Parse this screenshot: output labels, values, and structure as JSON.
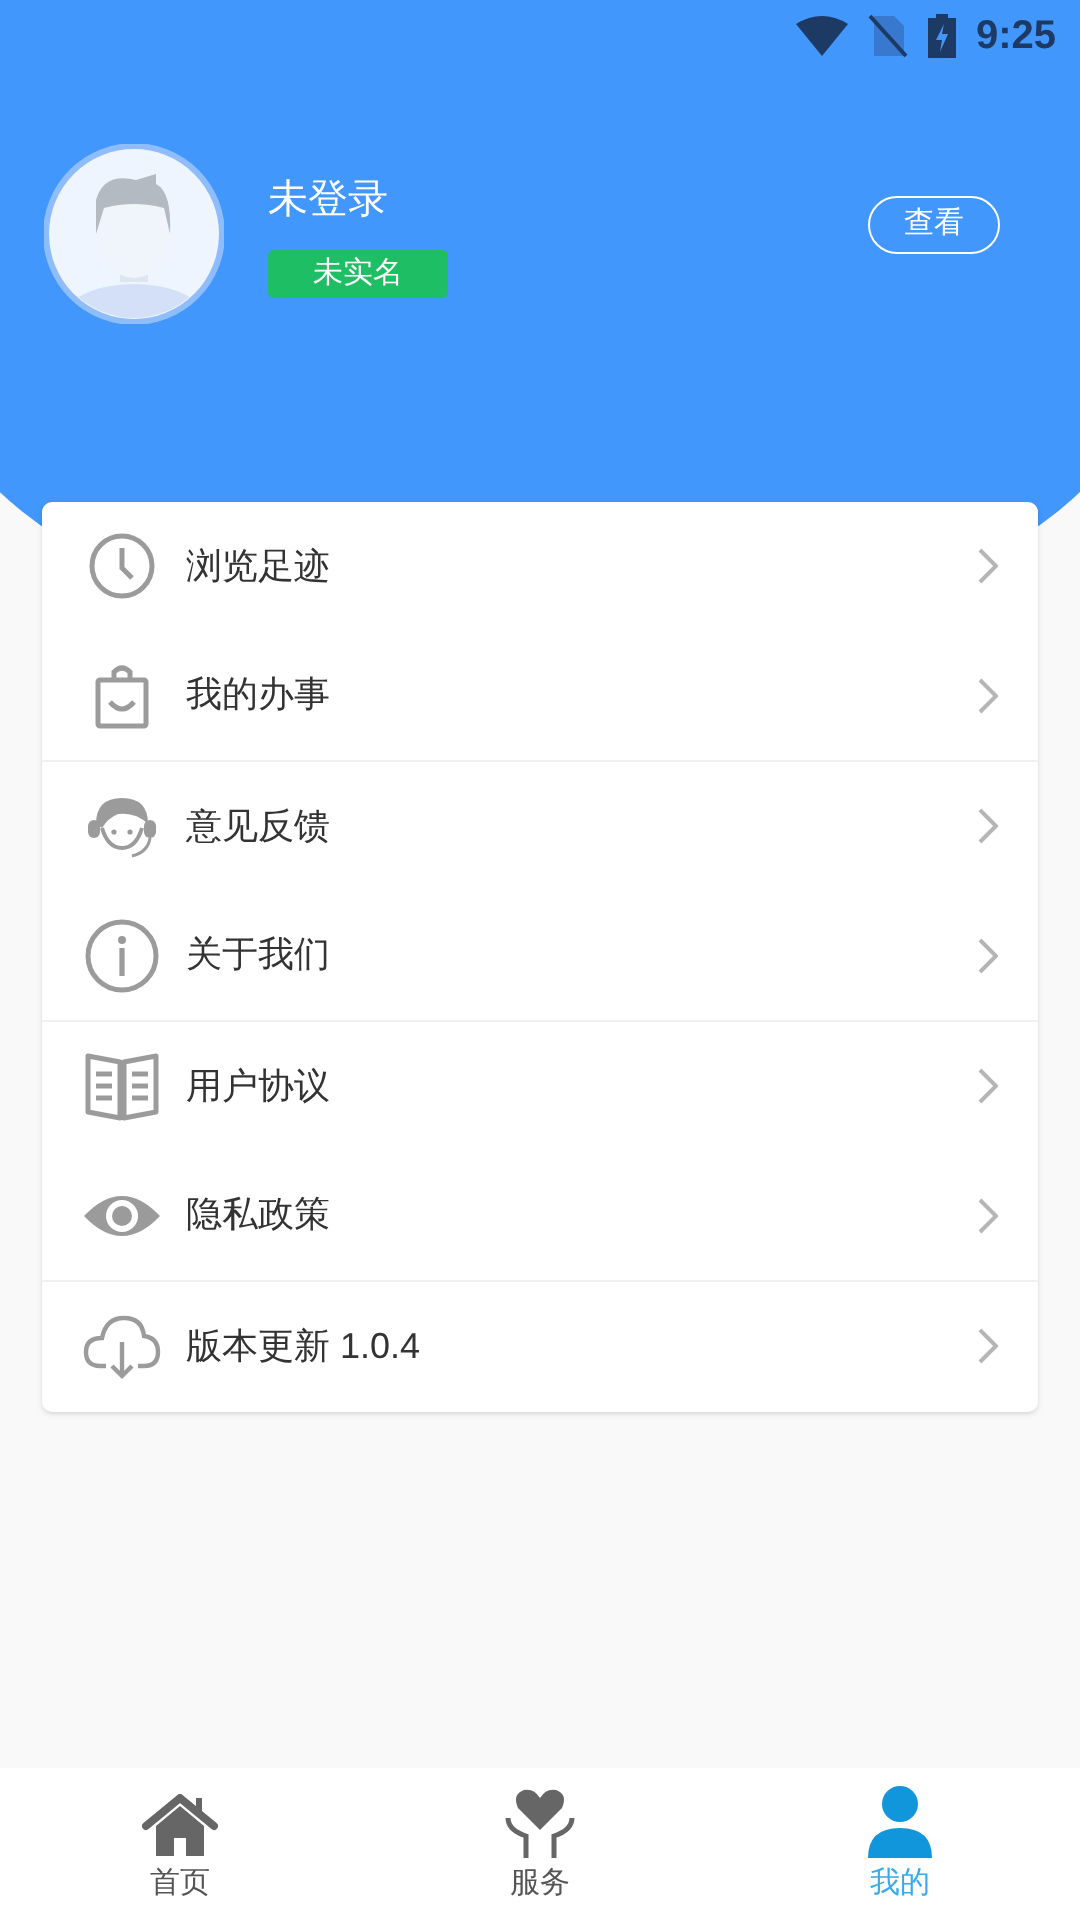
{
  "status_bar": {
    "time": "9:25"
  },
  "profile": {
    "name": "未登录",
    "badge": "未实名",
    "button": "查看"
  },
  "menu_groups": [
    {
      "items": [
        {
          "kind": "clock",
          "label": "浏览足迹"
        },
        {
          "kind": "bag",
          "label": "我的办事"
        }
      ]
    },
    {
      "items": [
        {
          "kind": "headset",
          "label": "意见反馈"
        },
        {
          "kind": "info",
          "label": "关于我们"
        }
      ]
    },
    {
      "items": [
        {
          "kind": "book",
          "label": "用户协议"
        },
        {
          "kind": "eye",
          "label": "隐私政策"
        }
      ]
    },
    {
      "items": [
        {
          "kind": "cloud",
          "label": "版本更新 1.0.4"
        }
      ]
    }
  ],
  "tabs": [
    {
      "kind": "home",
      "label": "首页",
      "selected": false
    },
    {
      "kind": "service",
      "label": "服务",
      "selected": false
    },
    {
      "kind": "person",
      "label": "我的",
      "selected": true
    }
  ]
}
